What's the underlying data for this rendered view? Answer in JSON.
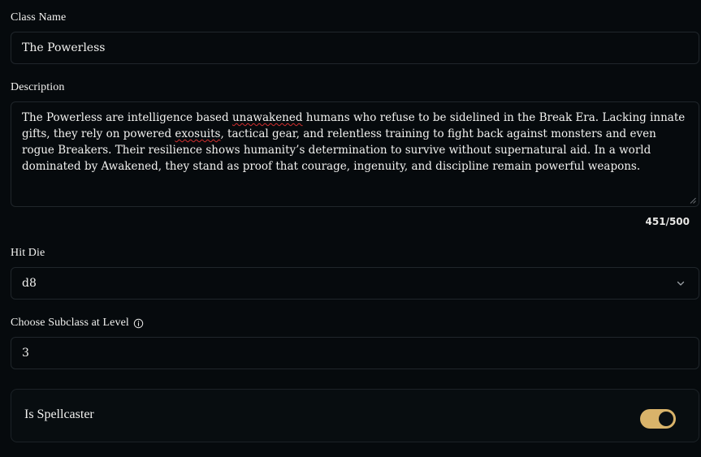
{
  "form": {
    "class_name": {
      "label": "Class Name",
      "value": "The Powerless"
    },
    "description": {
      "label": "Description",
      "segments": [
        {
          "text": "The Powerless are intelligence based ",
          "misspelled": false
        },
        {
          "text": "unawakened",
          "misspelled": true
        },
        {
          "text": " humans who refuse to be sidelined in the Break Era. Lacking innate gifts, they rely on powered ",
          "misspelled": false
        },
        {
          "text": "exosuits",
          "misspelled": true
        },
        {
          "text": ", tactical gear, and relentless training to fight back against monsters and even rogue Breakers. Their resilience shows humanity’s determination to survive without supernatural aid. In a world dominated by Awakened, they stand as proof that courage, ingenuity, and discipline remain powerful weapons.",
          "misspelled": false
        }
      ],
      "counter": "451/500"
    },
    "hit_die": {
      "label": "Hit Die",
      "value": "d8",
      "icon": "chevron-down-icon"
    },
    "subclass_level": {
      "label": "Choose Subclass at Level",
      "icon": "info-icon",
      "value": "3"
    },
    "spellcaster": {
      "label": "Is Spellcaster",
      "enabled": true,
      "accent_color": "#d9b36a"
    }
  }
}
